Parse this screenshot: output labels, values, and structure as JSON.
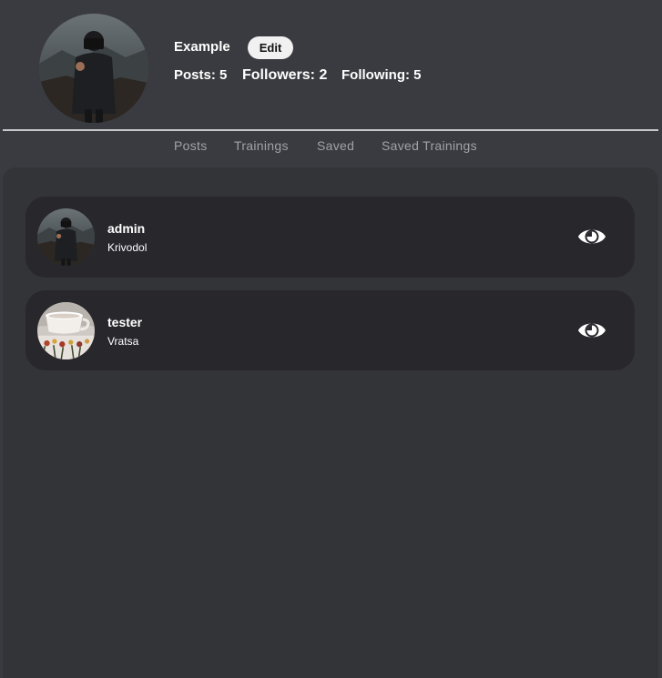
{
  "profile": {
    "username": "Example",
    "edit_label": "Edit",
    "avatar_icon": "profile-photo-person-with-camera",
    "stats": {
      "posts": "Posts: 5",
      "followers": "Followers: 2",
      "following": "Following: 5"
    }
  },
  "tabs": [
    {
      "label": "Posts"
    },
    {
      "label": "Trainings"
    },
    {
      "label": "Saved"
    },
    {
      "label": "Saved Trainings"
    }
  ],
  "users": [
    {
      "name": "admin",
      "location": "Krivodol",
      "avatar_icon": "person-with-camera-photo",
      "action_icon": "eye-icon"
    },
    {
      "name": "tester",
      "location": "Vratsa",
      "avatar_icon": "coffee-cup-flowers-photo",
      "action_icon": "eye-icon"
    }
  ],
  "colors": {
    "background": "#3a3b40",
    "panel": "#333438",
    "card": "#28272c",
    "tab_text": "#a1a2a6",
    "button_bg": "#f1f1f1"
  }
}
